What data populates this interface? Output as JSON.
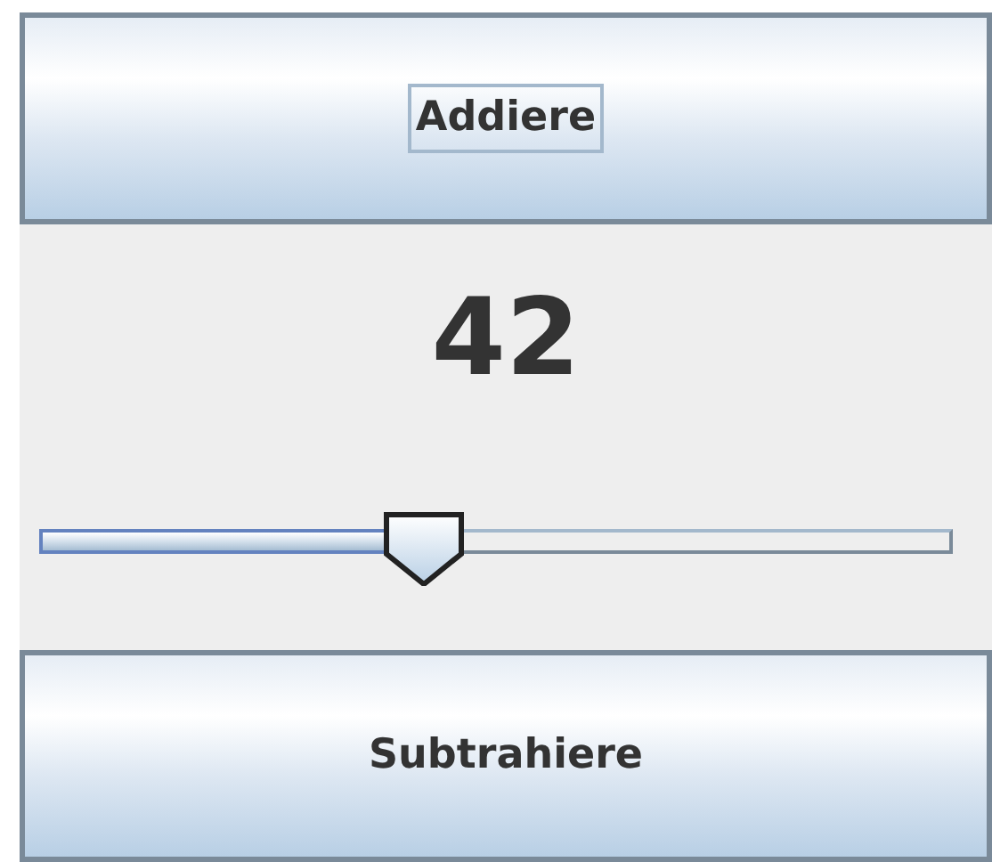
{
  "buttons": [
    {
      "label": "Addiere",
      "focused": true
    },
    {
      "label": "Subtrahiere",
      "focused": false
    }
  ],
  "value_label": "42",
  "slider": {
    "level": 0.42
  }
}
